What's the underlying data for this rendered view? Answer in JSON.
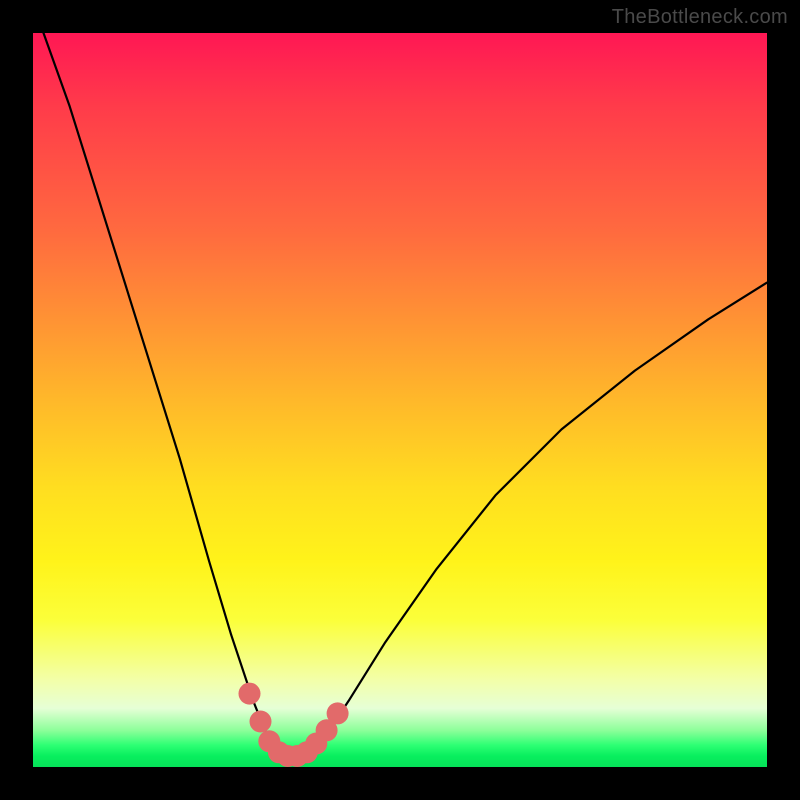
{
  "watermark": "TheBottleneck.com",
  "chart_data": {
    "type": "line",
    "title": "",
    "xlabel": "",
    "ylabel": "",
    "xlim": [
      0,
      100
    ],
    "ylim": [
      0,
      100
    ],
    "series": [
      {
        "name": "bottleneck-curve",
        "x": [
          0,
          5,
          10,
          15,
          20,
          24,
          27,
          30,
          32,
          33,
          34,
          35,
          36,
          37,
          38,
          40,
          43,
          48,
          55,
          63,
          72,
          82,
          92,
          100
        ],
        "values": [
          104,
          90,
          74,
          58,
          42,
          28,
          18,
          9,
          4,
          2.2,
          1.5,
          1.3,
          1.3,
          1.5,
          2.3,
          4.5,
          9,
          17,
          27,
          37,
          46,
          54,
          61,
          66
        ]
      }
    ],
    "markers": {
      "name": "highlight-points",
      "color": "#e26a6a",
      "x": [
        29.5,
        31.0,
        32.2,
        33.5,
        34.7,
        36.0,
        37.3,
        38.6,
        40.0,
        41.5
      ],
      "values": [
        10.0,
        6.2,
        3.5,
        2.0,
        1.5,
        1.5,
        2.0,
        3.2,
        5.0,
        7.3
      ]
    },
    "gradient_stops": [
      {
        "pos": 0.0,
        "color": "#ff1754"
      },
      {
        "pos": 0.27,
        "color": "#ff6a3f"
      },
      {
        "pos": 0.5,
        "color": "#ffb82a"
      },
      {
        "pos": 0.72,
        "color": "#fff31a"
      },
      {
        "pos": 0.9,
        "color": "#efffc0"
      },
      {
        "pos": 0.97,
        "color": "#2eff74"
      },
      {
        "pos": 1.0,
        "color": "#06e259"
      }
    ]
  }
}
